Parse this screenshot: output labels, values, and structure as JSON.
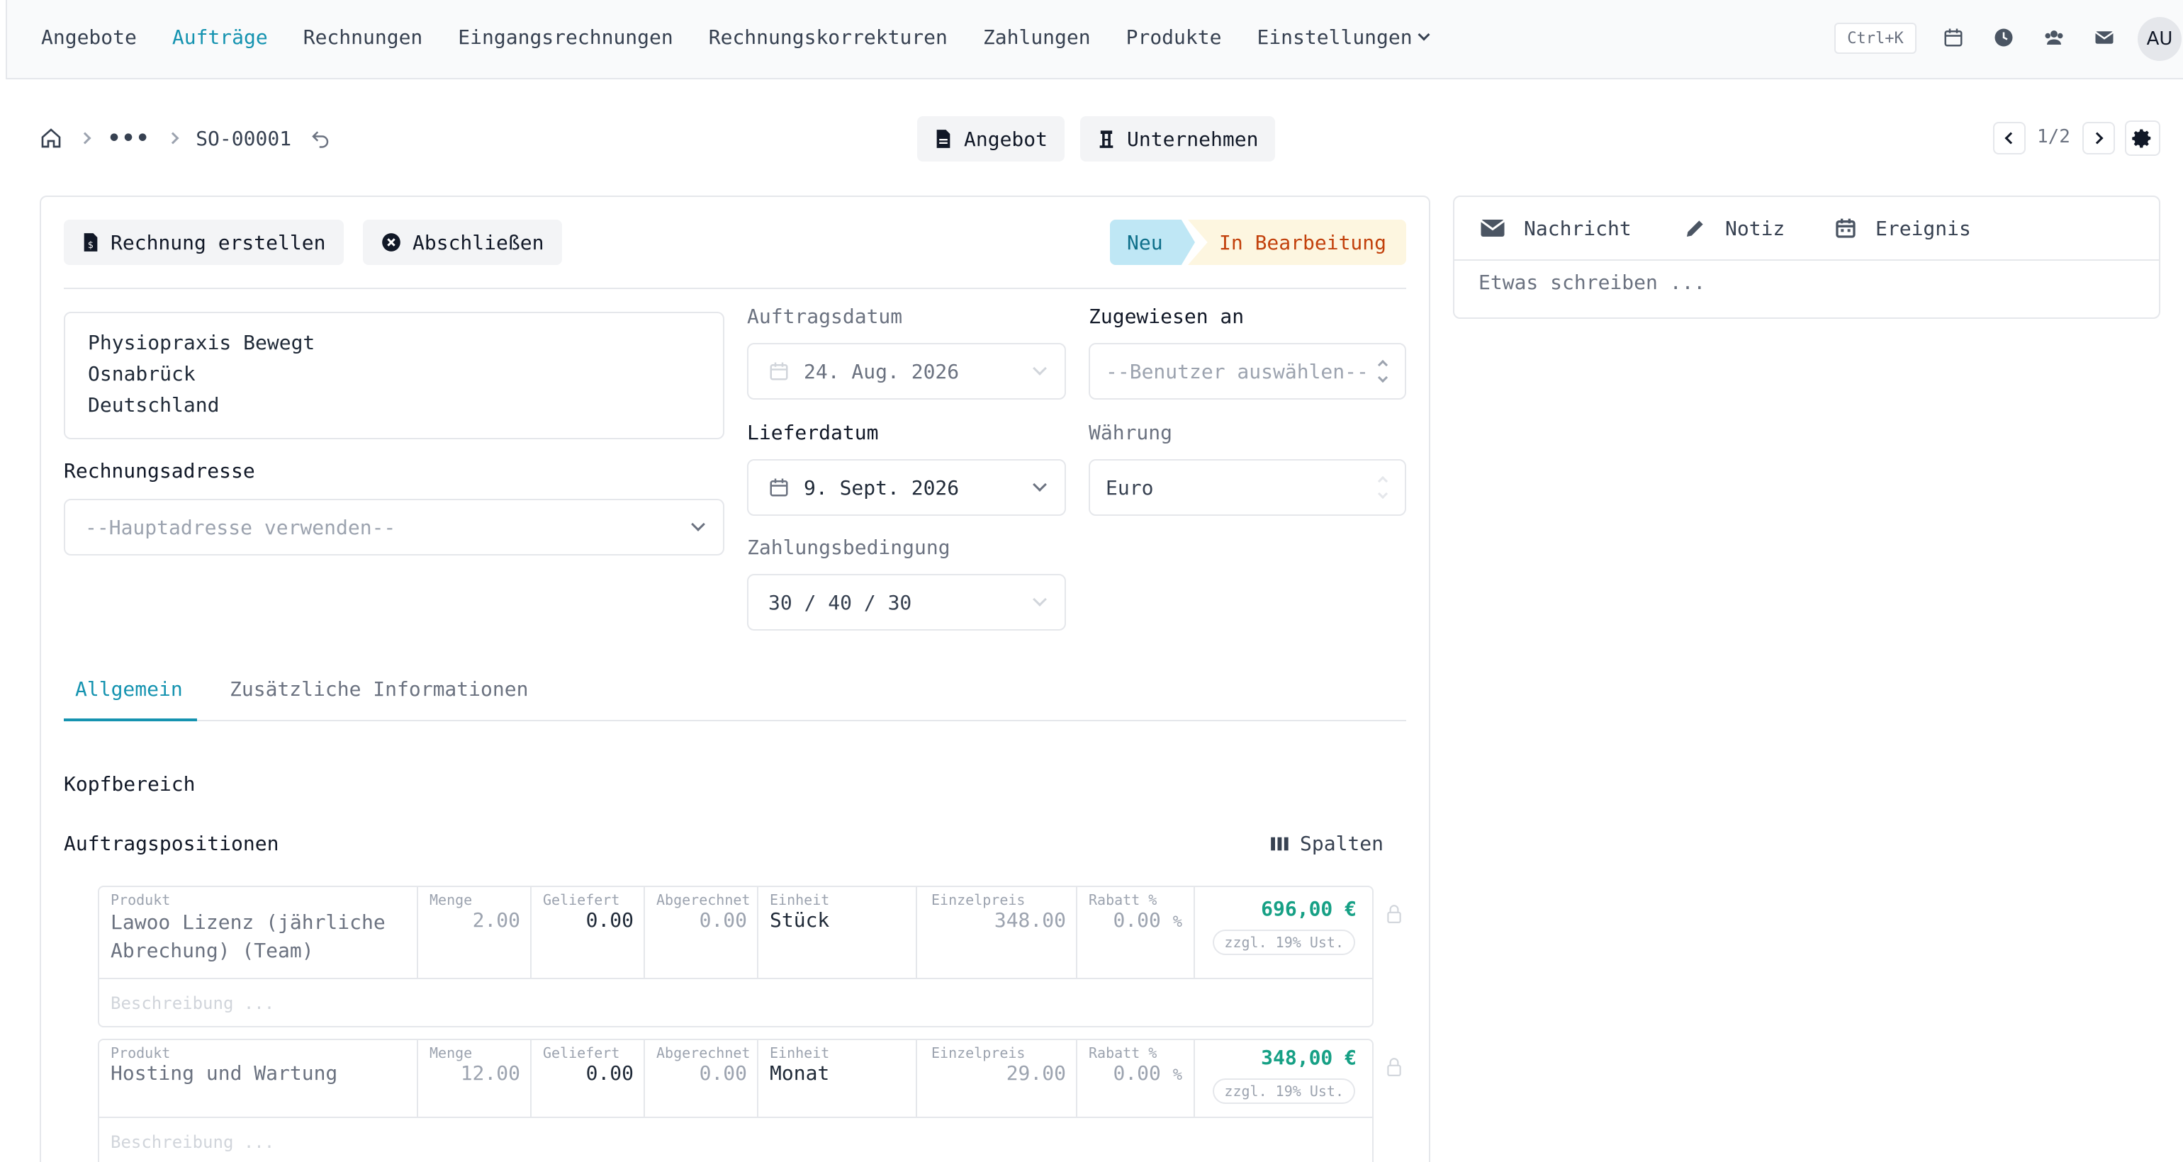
{
  "nav": {
    "items": [
      "Angebote",
      "Aufträge",
      "Rechnungen",
      "Eingangsrechnungen",
      "Rechnungskorrekturen",
      "Zahlungen",
      "Produkte",
      "Einstellungen"
    ],
    "active_index": 1,
    "shortcut": "Ctrl+K",
    "avatar": "AU"
  },
  "breadcrumb": {
    "ellipsis": "•••",
    "current": "SO-00001"
  },
  "header_buttons": {
    "quote": "Angebot",
    "company": "Unternehmen"
  },
  "pager": {
    "text": "1/2"
  },
  "actions": {
    "create_invoice": "Rechnung erstellen",
    "close": "Abschließen"
  },
  "status": {
    "steps": [
      "Neu",
      "In Bearbeitung"
    ]
  },
  "customer": {
    "name": "Physiopraxis Bewegt",
    "city": "Osnabrück",
    "country": "Deutschland"
  },
  "billing": {
    "label": "Rechnungsadresse",
    "placeholder": "--Hauptadresse verwenden--"
  },
  "order_date": {
    "label": "Auftragsdatum",
    "value": "24. Aug. 2026"
  },
  "delivery_date": {
    "label": "Lieferdatum",
    "value": "9. Sept. 2026"
  },
  "payment_terms": {
    "label": "Zahlungsbedingung",
    "value": "30 / 40 / 30"
  },
  "assigned": {
    "label": "Zugewiesen an",
    "placeholder": "--Benutzer auswählen--"
  },
  "currency": {
    "label": "Währung",
    "value": "Euro"
  },
  "tabs": [
    "Allgemein",
    "Zusätzliche Informationen"
  ],
  "sections": {
    "header": "Kopfbereich",
    "positions": "Auftragspositionen",
    "columns_button": "Spalten"
  },
  "line_items": {
    "labels": {
      "product": "Produkt",
      "qty": "Menge",
      "delivered": "Geliefert",
      "billed": "Abgerechnet",
      "unit": "Einheit",
      "price": "Einzelpreis",
      "discount": "Rabatt %",
      "percent": "%",
      "vat": "zzgl. 19% Ust.",
      "description_placeholder": "Beschreibung ..."
    },
    "rows": [
      {
        "product_line1": "Lawoo Lizenz (jährliche",
        "product_line2": "Abrechung) (Team)",
        "qty": "2.00",
        "delivered": "0.00",
        "billed": "0.00",
        "unit": "Stück",
        "price": "348.00",
        "discount": "0.00",
        "total": "696,00 €"
      },
      {
        "product_line1": "Hosting und Wartung",
        "product_line2": "",
        "qty": "12.00",
        "delivered": "0.00",
        "billed": "0.00",
        "unit": "Monat",
        "price": "29.00",
        "discount": "0.00",
        "total": "348,00 €"
      }
    ]
  },
  "chatter": {
    "message": "Nachricht",
    "note": "Notiz",
    "event": "Ereignis",
    "placeholder": "Etwas schreiben ..."
  },
  "colors": {
    "accent": "#1593b0",
    "total_green": "#16a085",
    "status_new_bg": "#bfe7f5",
    "status_progress_text": "#c2410c"
  }
}
